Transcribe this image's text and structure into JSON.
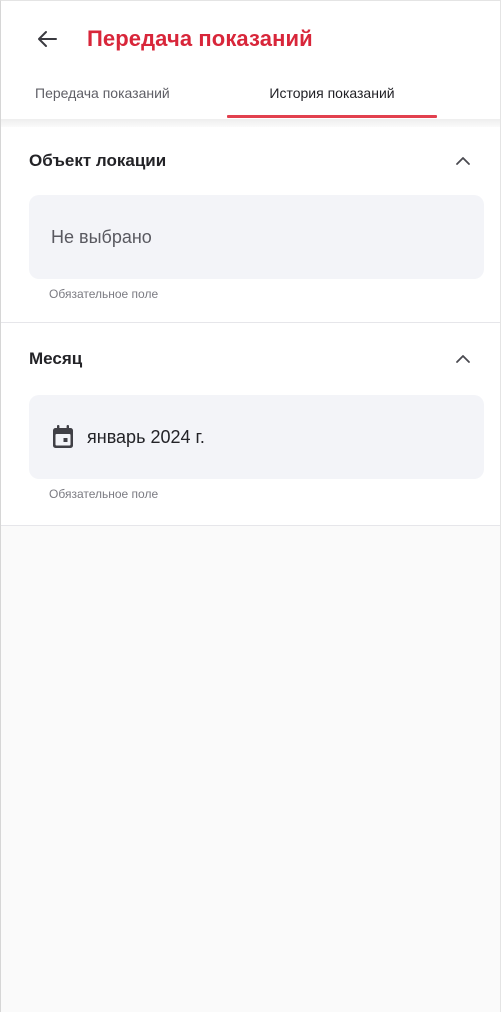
{
  "header": {
    "title": "Передача показаний",
    "back_icon": "arrow-left-icon"
  },
  "tabs": [
    {
      "label": "Передача показаний",
      "active": false
    },
    {
      "label": "История показаний",
      "active": true
    }
  ],
  "accent_color": "#d8263a",
  "sections": [
    {
      "title": "Объект локации",
      "expanded": true,
      "field_value": "Не выбрано",
      "field_is_placeholder": true,
      "helper": "Обязательное поле"
    },
    {
      "title": "Месяц",
      "expanded": true,
      "field_icon": "calendar-icon",
      "field_value": "январь 2024 г.",
      "helper": "Обязательное поле"
    }
  ]
}
